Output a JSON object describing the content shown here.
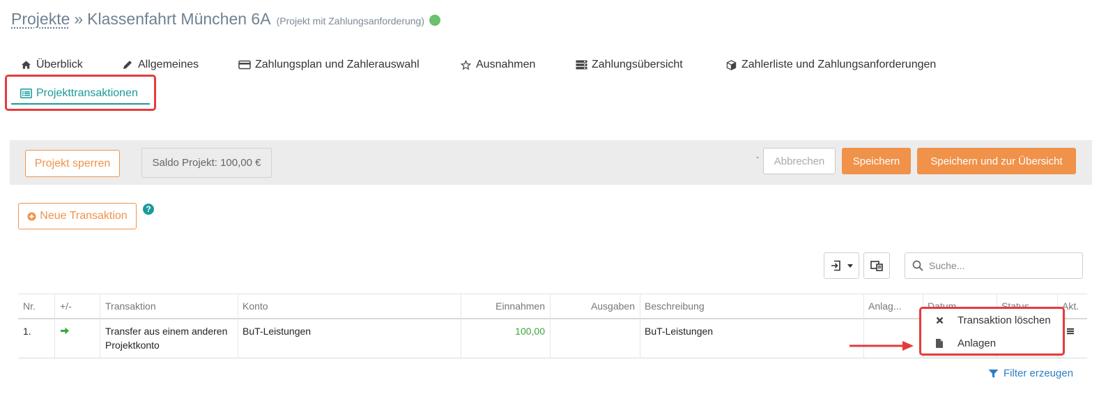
{
  "breadcrumb": {
    "link": "Projekte",
    "separator": "»",
    "title": "Klassenfahrt München 6A",
    "subtitle": "(Projekt mit Zahlungsanforderung)",
    "status_color": "#6cc070"
  },
  "tabs": [
    {
      "label": "Überblick",
      "icon": "home-icon"
    },
    {
      "label": "Allgemeines",
      "icon": "pencil-icon"
    },
    {
      "label": "Zahlungsplan und Zahlerauswahl",
      "icon": "credit-card-icon"
    },
    {
      "label": "Ausnahmen",
      "icon": "star-icon"
    },
    {
      "label": "Zahlungsübersicht",
      "icon": "server-icon"
    },
    {
      "label": "Zahlerliste und Zahlungsanforderungen",
      "icon": "cube-icon"
    },
    {
      "label": "Projekttransaktionen",
      "icon": "list-alt-icon",
      "active": true
    }
  ],
  "toolbar": {
    "lock_label": "Projekt sperren",
    "balance": "Saldo Projekt: 100,00 €",
    "backtick": "`",
    "cancel_label": "Abbrechen",
    "save_label": "Speichern",
    "save_overview_label": "Speichern und zur Übersicht"
  },
  "new_transaction_label": "Neue Transaktion",
  "help": "?",
  "search": {
    "placeholder": "Suche..."
  },
  "table": {
    "headers": [
      "Nr.",
      "+/-",
      "Transaktion",
      "Konto",
      "Einnahmen",
      "Ausgaben",
      "Beschreibung",
      "Anlag...",
      "Datum",
      "Status",
      "Akt."
    ],
    "rows": [
      {
        "nr": "1.",
        "direction": "arrow-right-icon",
        "transaktion_line1": "Transfer aus einem anderen",
        "transaktion_line2": "Projektkonto",
        "konto": "BuT-Leistungen",
        "einnahmen": "100,00",
        "ausgaben": "",
        "beschreibung": "BuT-Leistungen"
      }
    ]
  },
  "dropdown": {
    "items": [
      {
        "label": "Transaktion löschen",
        "icon": "close-icon"
      },
      {
        "label": "Anlagen",
        "icon": "file-icon"
      }
    ]
  },
  "filter_link": "Filter erzeugen",
  "colors": {
    "accent_teal": "#1a9a9a",
    "orange": "#f0924a",
    "income_green": "#3aa63a",
    "annotation_red": "#e53b3b",
    "link_blue": "#2a7fc4"
  }
}
